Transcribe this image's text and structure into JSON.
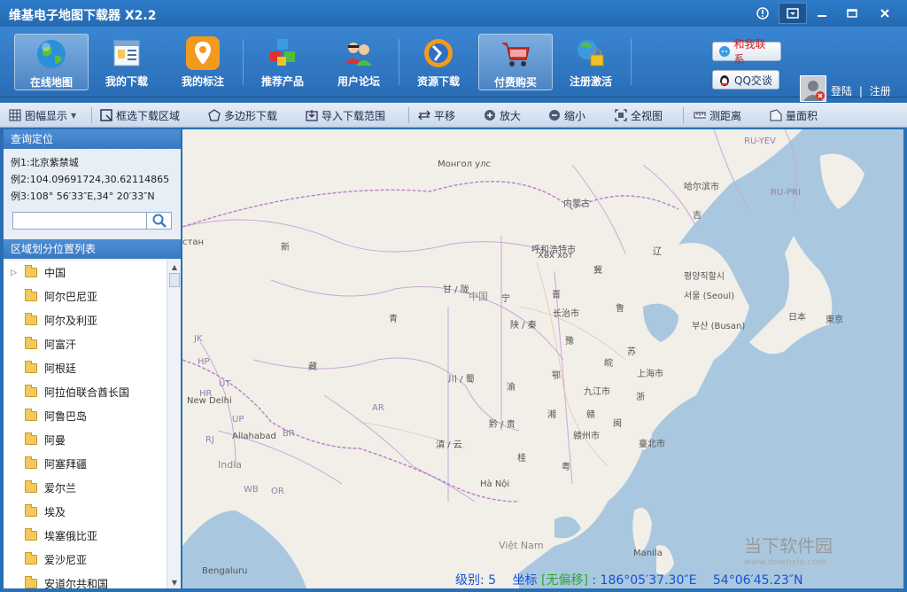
{
  "window": {
    "title": "维基电子地图下载器 X2.2"
  },
  "main_toolbar": [
    {
      "label": "在线地图",
      "icon": "globe-icon"
    },
    {
      "label": "我的下载",
      "icon": "download-list-icon"
    },
    {
      "label": "我的标注",
      "icon": "map-pin-icon"
    },
    {
      "label": "推荐产品",
      "icon": "cubes-icon"
    },
    {
      "label": "用户论坛",
      "icon": "users-icon"
    },
    {
      "label": "资源下载",
      "icon": "resource-globe-icon"
    },
    {
      "label": "付费购买",
      "icon": "cart-icon"
    },
    {
      "label": "注册激活",
      "icon": "lock-icon"
    }
  ],
  "contact": {
    "contact_label": "和我联系",
    "qq_label": "QQ交谈"
  },
  "account": {
    "login": "登陆",
    "separator": "|",
    "register": "注册"
  },
  "sub_toolbar": [
    {
      "label": "图幅显示",
      "icon": "grid-icon"
    },
    {
      "label": "框选下载区域",
      "icon": "box-select-icon"
    },
    {
      "label": "多边形下载",
      "icon": "polygon-icon"
    },
    {
      "label": "导入下载范围",
      "icon": "import-icon"
    },
    {
      "label": "平移",
      "icon": "pan-icon"
    },
    {
      "label": "放大",
      "icon": "zoom-in-icon"
    },
    {
      "label": "缩小",
      "icon": "zoom-out-icon"
    },
    {
      "label": "全视图",
      "icon": "full-view-icon"
    },
    {
      "label": "测距离",
      "icon": "ruler-icon"
    },
    {
      "label": "量面积",
      "icon": "area-icon"
    }
  ],
  "search_panel": {
    "title": "查询定位",
    "examples": [
      "例1:北京紫禁城",
      "例2:104.09691724,30.62114865",
      "例3:108° 56′33″E,34° 20′33″N"
    ],
    "input_value": ""
  },
  "region_panel": {
    "title": "区域划分位置列表",
    "items": [
      "中国",
      "阿尔巴尼亚",
      "阿尔及利亚",
      "阿富汗",
      "阿根廷",
      "阿拉伯联合酋长国",
      "阿鲁巴岛",
      "阿曼",
      "阿塞拜疆",
      "爱尔兰",
      "埃及",
      "埃塞俄比亚",
      "爱沙尼亚",
      "安道尔共和国"
    ]
  },
  "map_labels": [
    "Монгол улс",
    "内蒙古",
    "哈尔滨市",
    "吉",
    "RU-YEV",
    "RU-PRI",
    "新",
    "呼和浩特市",
    "Хөх хот",
    "辽",
    "冀",
    "평양직할시",
    "서울 (Seoul)",
    "부산 (Busan)",
    "日本",
    "東京",
    "甘 / 陇",
    "中国",
    "宁",
    "晋",
    "鲁",
    "长治市",
    "青",
    "陕 / 秦",
    "豫",
    "苏",
    "藏",
    "皖",
    "上海市",
    "川 / 蜀",
    "渝",
    "鄂",
    "九江市",
    "浙",
    "New Delhi",
    "湘",
    "赣",
    "闽",
    "黔 / 贵",
    "赣州市",
    "Allahabad",
    "滇 / 云",
    "桂",
    "臺北市",
    "粤",
    "India",
    "Hà Nội",
    "Việt Nam",
    "Bengaluru",
    "Manila",
    "JK",
    "HP",
    "UT",
    "HR",
    "UP",
    "RJ",
    "BR",
    "WB",
    "OR",
    "AR",
    "стан"
  ],
  "status": {
    "level_label": "级别:",
    "level_value": "5",
    "coord_label": "坐标",
    "offset_tag": "[无偏移]",
    "longitude": ": 186°05′37.30″E",
    "latitude": "54°06′45.23″N"
  },
  "watermark": {
    "text": "当下软件园",
    "url": "www.downxia.com"
  }
}
